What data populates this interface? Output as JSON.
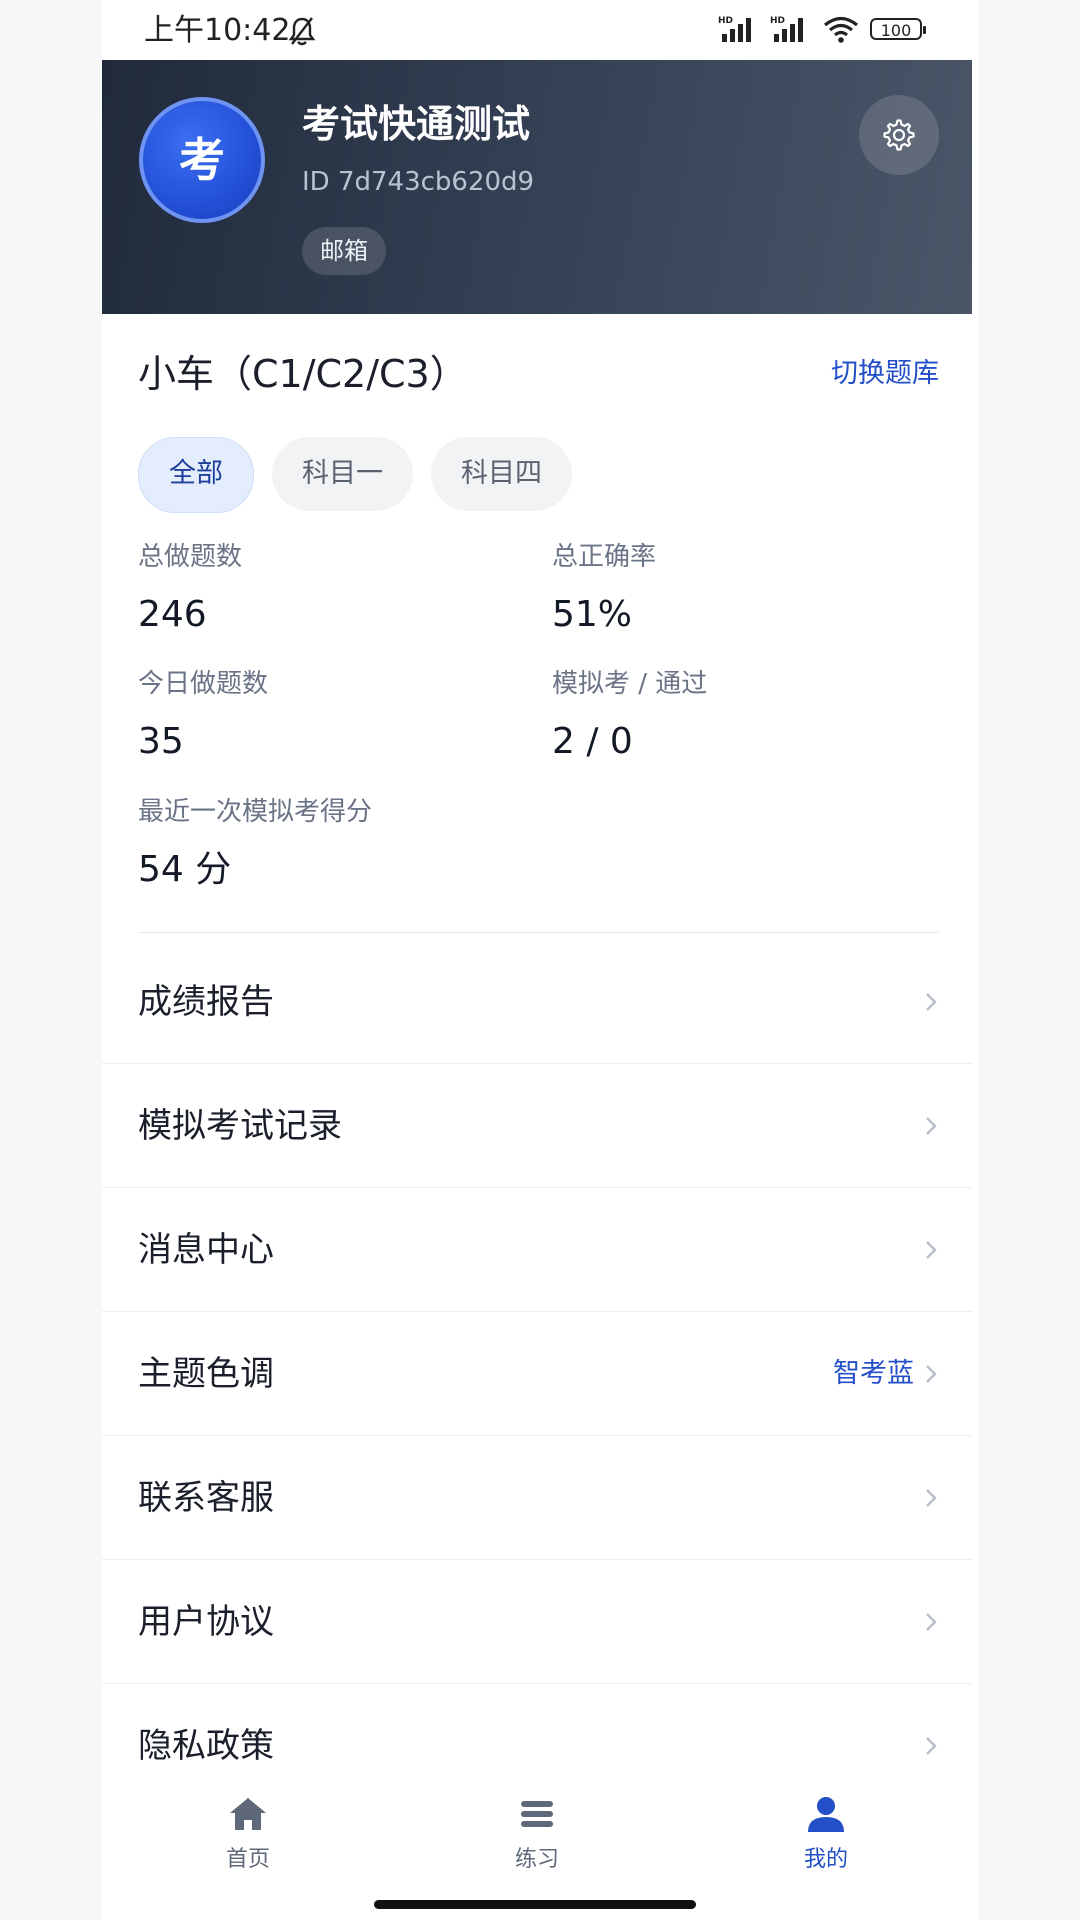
{
  "status_bar": {
    "time": "上午10:42",
    "battery": "100",
    "signal_label_1": "HD",
    "signal_label_2": "HD"
  },
  "profile": {
    "avatar_char": "考",
    "name": "考试快通测试",
    "id": "ID 7d743cb620d9",
    "badge": "邮箱"
  },
  "bank": {
    "name": "小车（C1/C2/C3）",
    "switch_label": "切换题库"
  },
  "tabs": [
    {
      "label": "全部",
      "active": true
    },
    {
      "label": "科目一",
      "active": false
    },
    {
      "label": "科目四",
      "active": false
    }
  ],
  "stats": {
    "total_label": "总做题数",
    "total_value": "246",
    "accuracy_label": "总正确率",
    "accuracy_value": "51%",
    "today_label": "今日做题数",
    "today_value": "35",
    "mock_label": "模拟考 / 通过",
    "mock_value": "2 / 0",
    "last_score_label": "最近一次模拟考得分",
    "last_score_value": "54 分"
  },
  "menu": [
    {
      "label": "成绩报告",
      "value": ""
    },
    {
      "label": "模拟考试记录",
      "value": ""
    },
    {
      "label": "消息中心",
      "value": ""
    },
    {
      "label": "主题色调",
      "value": "智考蓝"
    },
    {
      "label": "联系客服",
      "value": ""
    },
    {
      "label": "用户协议",
      "value": ""
    },
    {
      "label": "隐私政策",
      "value": ""
    }
  ],
  "nav": [
    {
      "label": "首页",
      "icon": "home-icon"
    },
    {
      "label": "练习",
      "icon": "list-icon"
    },
    {
      "label": "我的",
      "icon": "user-icon",
      "active": true
    }
  ],
  "colors": {
    "accent": "#2350c8",
    "header_dark": "#202a3c",
    "avatar_blue": "#2350d8"
  }
}
